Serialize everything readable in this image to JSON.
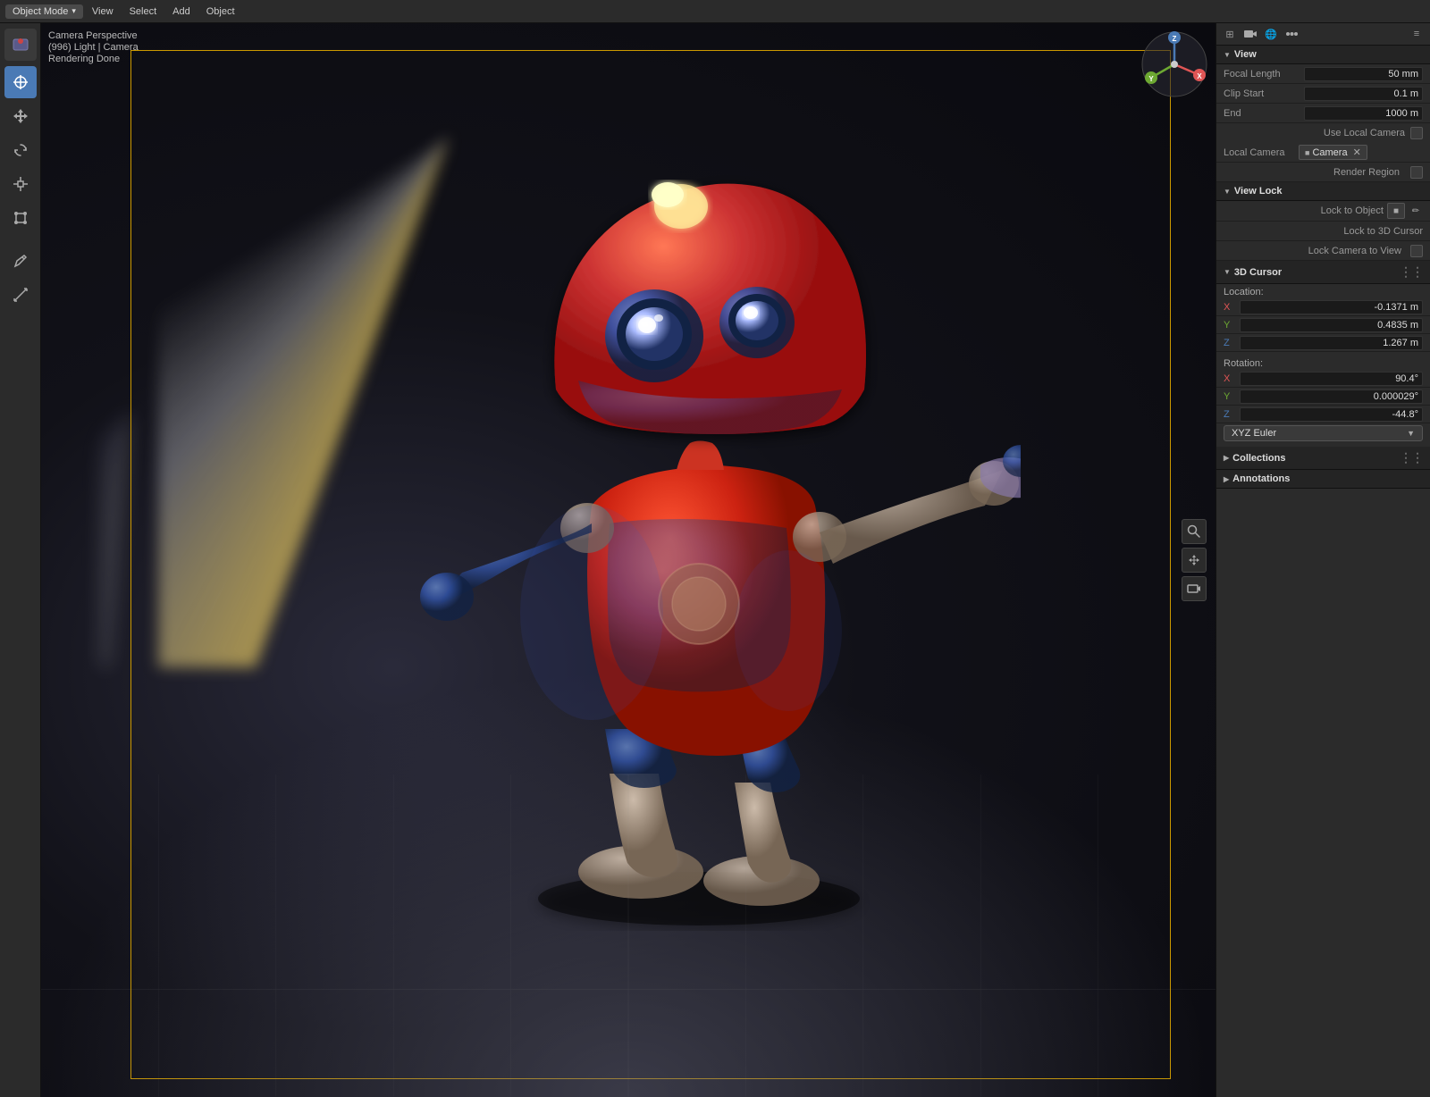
{
  "topbar": {
    "mode_label": "Object Mode",
    "menus": [
      "View",
      "Select",
      "Add",
      "Object"
    ]
  },
  "viewport_info": {
    "line1": "Camera Perspective",
    "line2": "(996) Light | Camera",
    "line3": "Rendering Done"
  },
  "right_panel": {
    "title": "View",
    "sections": {
      "view": {
        "focal_length_label": "Focal Length",
        "focal_length_value": "50 mm",
        "clip_start_label": "Clip Start",
        "clip_start_value": "0.1 m",
        "clip_end_label": "End",
        "clip_end_value": "1000 m",
        "local_camera_label": "Local Camera",
        "camera_chip_label": "Camera",
        "use_local_camera_label": "Use Local Camera",
        "render_region_label": "Render Region"
      },
      "view_lock": {
        "title": "View Lock",
        "lock_to_object_label": "Lock to Object",
        "lock_to_3d_cursor_label": "Lock to 3D Cursor",
        "lock_camera_to_view_label": "Lock Camera to View"
      },
      "cursor_3d": {
        "title": "3D Cursor",
        "location_label": "Location:",
        "x_value": "-0.1371 m",
        "y_value": "0.4835 m",
        "z_value": "1.267 m",
        "rotation_label": "Rotation:",
        "rx_value": "90.4°",
        "ry_value": "0.000029°",
        "rz_value": "-44.8°",
        "euler_label": "XYZ Euler"
      },
      "collections": {
        "title": "Collections"
      },
      "annotations": {
        "title": "Annotations"
      }
    }
  },
  "left_tools": [
    {
      "name": "cursor",
      "icon": "✛",
      "active": false
    },
    {
      "name": "move",
      "icon": "⊹",
      "active": true
    },
    {
      "name": "rotate",
      "icon": "↻",
      "active": false
    },
    {
      "name": "scale",
      "icon": "⤡",
      "active": false
    },
    {
      "name": "transform",
      "icon": "⊞",
      "active": false
    },
    {
      "name": "separator1",
      "icon": "",
      "active": false
    },
    {
      "name": "annotate",
      "icon": "✏",
      "active": false
    },
    {
      "name": "measure",
      "icon": "📐",
      "active": false
    }
  ],
  "gizmo": {
    "x_color": "#e05555",
    "y_color": "#6da832",
    "z_color": "#4a7ab5"
  }
}
